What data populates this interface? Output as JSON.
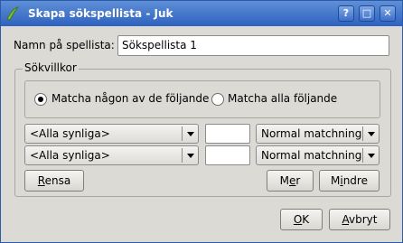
{
  "window": {
    "title": "Skapa sökspellista - Juk",
    "buttons": {
      "help": "?",
      "maximize": "□",
      "close": "✕"
    }
  },
  "name_field": {
    "label": "Namn på spellista:",
    "value": "Sökspellista 1"
  },
  "criteria": {
    "group_title": "Sökvillkor",
    "match_any": {
      "label": "Matcha någon av de följande",
      "checked": true
    },
    "match_all": {
      "label": "Matcha alla följande",
      "checked": false
    },
    "rows": [
      {
        "field": "<Alla synliga>",
        "value": "",
        "mode": "Normal matchning"
      },
      {
        "field": "<Alla synliga>",
        "value": "",
        "mode": "Normal matchning"
      }
    ],
    "clear_button": {
      "mnemonic": "R",
      "rest": "ensa"
    },
    "more_button": {
      "pre": "M",
      "mnemonic": "e",
      "rest": "r"
    },
    "fewer_button": {
      "pre": "M",
      "mnemonic": "i",
      "rest": "ndre"
    }
  },
  "footer": {
    "ok_button": {
      "mnemonic": "O",
      "rest": "K"
    },
    "cancel_button": {
      "mnemonic": "A",
      "rest": "vbryt"
    }
  }
}
